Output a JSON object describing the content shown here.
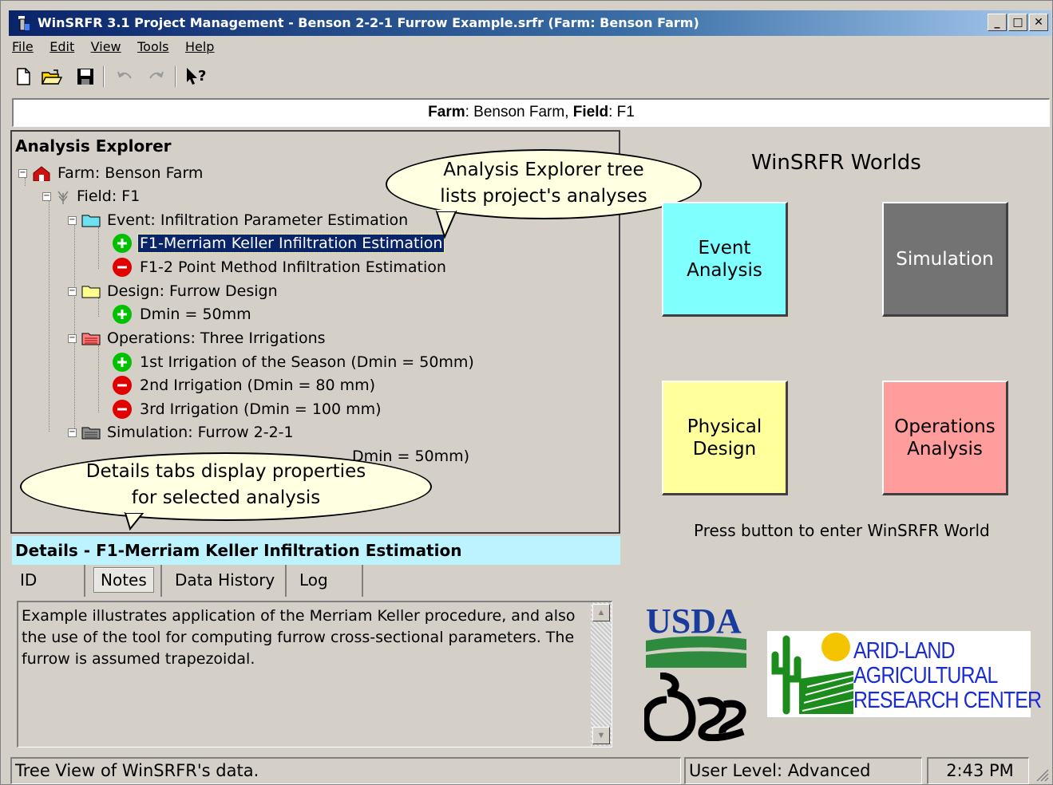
{
  "window": {
    "title": "WinSRFR 3.1 Project Management - Benson 2-2-1 Furrow Example.srfr (Farm: Benson Farm)",
    "minimize": "_",
    "maximize": "□",
    "close": "✕"
  },
  "menu": [
    "File",
    "Edit",
    "View",
    "Tools",
    "Help"
  ],
  "toolbar": {
    "icons": [
      "new-file-icon",
      "open-folder-icon",
      "save-icon",
      "undo-icon",
      "redo-icon",
      "context-help-icon"
    ]
  },
  "infobar": {
    "farm_label": "Farm",
    "farm_value": ": Benson Farm, ",
    "field_label": "Field",
    "field_value": ": F1"
  },
  "explorer": {
    "title": "Analysis Explorer",
    "farm": "Farm: Benson Farm",
    "field": "Field: F1",
    "event_group": "Event: Infiltration Parameter Estimation",
    "event_items": [
      {
        "label": "F1-Merriam Keller Infiltration Estimation",
        "status": "ok"
      },
      {
        "label": "F1-2 Point Method Infiltration Estimation",
        "status": "error"
      }
    ],
    "design_group": "Design: Furrow Design",
    "design_items": [
      {
        "label": "Dmin = 50mm",
        "status": "ok"
      }
    ],
    "operations_group": "Operations: Three Irrigations",
    "operations_items": [
      {
        "label": "1st Irrigation of the Season (Dmin = 50mm)",
        "status": "ok"
      },
      {
        "label": "2nd Irrigation (Dmin = 80 mm)",
        "status": "error"
      },
      {
        "label": "3rd Irrigation (Dmin = 100 mm)",
        "status": "error"
      }
    ],
    "simulation_group": "Simulation: Furrow 2-2-1",
    "simulation_item_partial": "Dmin = 50mm)"
  },
  "callouts": {
    "tree": "Analysis Explorer tree\nlists project's analyses",
    "details": "Details tabs display properties\nfor selected analysis"
  },
  "details": {
    "header": "Details - F1-Merriam Keller Infiltration Estimation",
    "tabs": [
      "ID",
      "Notes",
      "Data History",
      "Log"
    ],
    "active_tab": "Notes",
    "notes_line1": "Example illustrates application of the Merriam Keller procedure, and also",
    "notes_line2": "the use of the tool for computing furrow cross-sectional parameters.  The",
    "notes_line3": "furrow is assumed trapezoidal."
  },
  "worlds": {
    "title": "WinSRFR Worlds",
    "buttons": [
      {
        "label1": "Event",
        "label2": "Analysis",
        "color": "#80ffff"
      },
      {
        "label1": "Simulation",
        "label2": "",
        "color": "#737373"
      },
      {
        "label1": "Physical",
        "label2": "Design",
        "color": "#ffff9c"
      },
      {
        "label1": "Operations",
        "label2": "Analysis",
        "color": "#ff9c9c"
      }
    ],
    "press_text": "Press button to enter WinSRFR World"
  },
  "logos": {
    "usda": "USDA",
    "ars": "ars",
    "aac_line1": "ARID-LAND",
    "aac_line2": "AGRICULTURAL",
    "aac_line3": "RESEARCH CENTER"
  },
  "statusbar": {
    "message": "Tree View of WinSRFR's data.",
    "user_level": "User Level:  Advanced",
    "time": "2:43 PM"
  },
  "colors": {
    "selected": "#0a246a",
    "details_header": "#bdf3ff",
    "ok_green": "#00c000",
    "error_red": "#e00000",
    "logo_blue": "#1a2bd6"
  }
}
